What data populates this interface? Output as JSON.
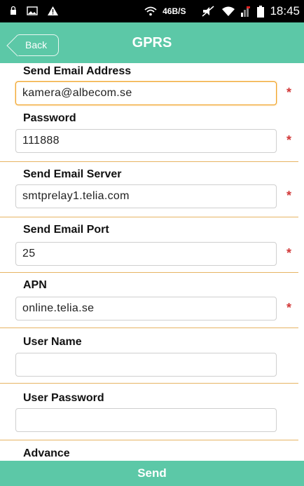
{
  "status_bar": {
    "network_speed": "46B/S",
    "time": "18:45"
  },
  "header": {
    "back_label": "Back",
    "title": "GPRS"
  },
  "form": {
    "send_email_address": {
      "label": "Send Email Address",
      "value": "kamera@albecom.se",
      "required": "*"
    },
    "password": {
      "label": "Password",
      "value": "111888",
      "required": "*"
    },
    "send_email_server": {
      "label": "Send Email Server",
      "value": "smtprelay1.telia.com",
      "required": "*"
    },
    "send_email_port": {
      "label": "Send Email Port",
      "value": "25",
      "required": "*"
    },
    "apn": {
      "label": "APN",
      "value": "online.telia.se",
      "required": "*"
    },
    "user_name": {
      "label": "User Name",
      "value": ""
    },
    "user_password": {
      "label": "User Password",
      "value": ""
    },
    "advance": {
      "label": "Advance"
    }
  },
  "footer": {
    "send_label": "Send"
  },
  "colors": {
    "accent": "#5cc8a7",
    "divider": "#e7b463",
    "required": "#d23a3a"
  }
}
